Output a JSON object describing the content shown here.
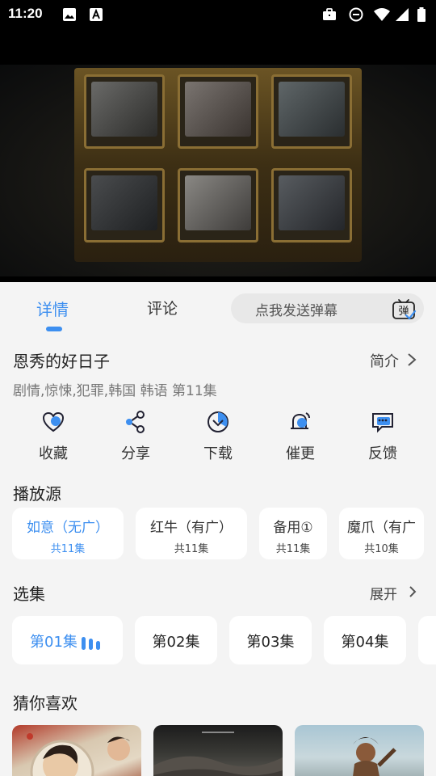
{
  "status_bar": {
    "time": "11:20",
    "icons": [
      "image-icon",
      "font-download-icon",
      "briefcase-icon",
      "do-not-disturb-icon",
      "wifi-icon",
      "signal-icon",
      "battery-icon"
    ]
  },
  "tabs": [
    {
      "label": "详情",
      "active": true
    },
    {
      "label": "评论",
      "active": false
    }
  ],
  "danmu": {
    "placeholder": "点我发送弹幕",
    "icon": "danmu-toggle-icon",
    "icon_text": "弹"
  },
  "show": {
    "title": "恩秀的好日子",
    "intro_label": "简介",
    "meta": "剧情,惊悚,犯罪,韩国 韩语 第11集"
  },
  "actions": [
    {
      "label": "收藏",
      "icon": "favorite-icon"
    },
    {
      "label": "分享",
      "icon": "share-icon"
    },
    {
      "label": "下载",
      "icon": "download-icon"
    },
    {
      "label": "催更",
      "icon": "remind-update-icon"
    },
    {
      "label": "反馈",
      "icon": "feedback-icon"
    }
  ],
  "sources": {
    "heading": "播放源",
    "items": [
      {
        "name": "如意（无广）",
        "count": "共11集",
        "active": true
      },
      {
        "name": "红牛（有广）",
        "count": "共11集",
        "active": false
      },
      {
        "name": "备用①",
        "count": "共11集",
        "active": false
      },
      {
        "name": "魔爪（有广",
        "count": "共10集",
        "active": false
      }
    ]
  },
  "episodes": {
    "heading": "选集",
    "expand_label": "展开",
    "items": [
      {
        "label": "第01集",
        "active": true
      },
      {
        "label": "第02集",
        "active": false
      },
      {
        "label": "第03集",
        "active": false
      },
      {
        "label": "第04集",
        "active": false
      }
    ]
  },
  "recommend": {
    "heading": "猜你喜欢"
  },
  "colors": {
    "accent": "#3d8ff0",
    "background": "#f4f4f4",
    "card": "#ffffff"
  }
}
